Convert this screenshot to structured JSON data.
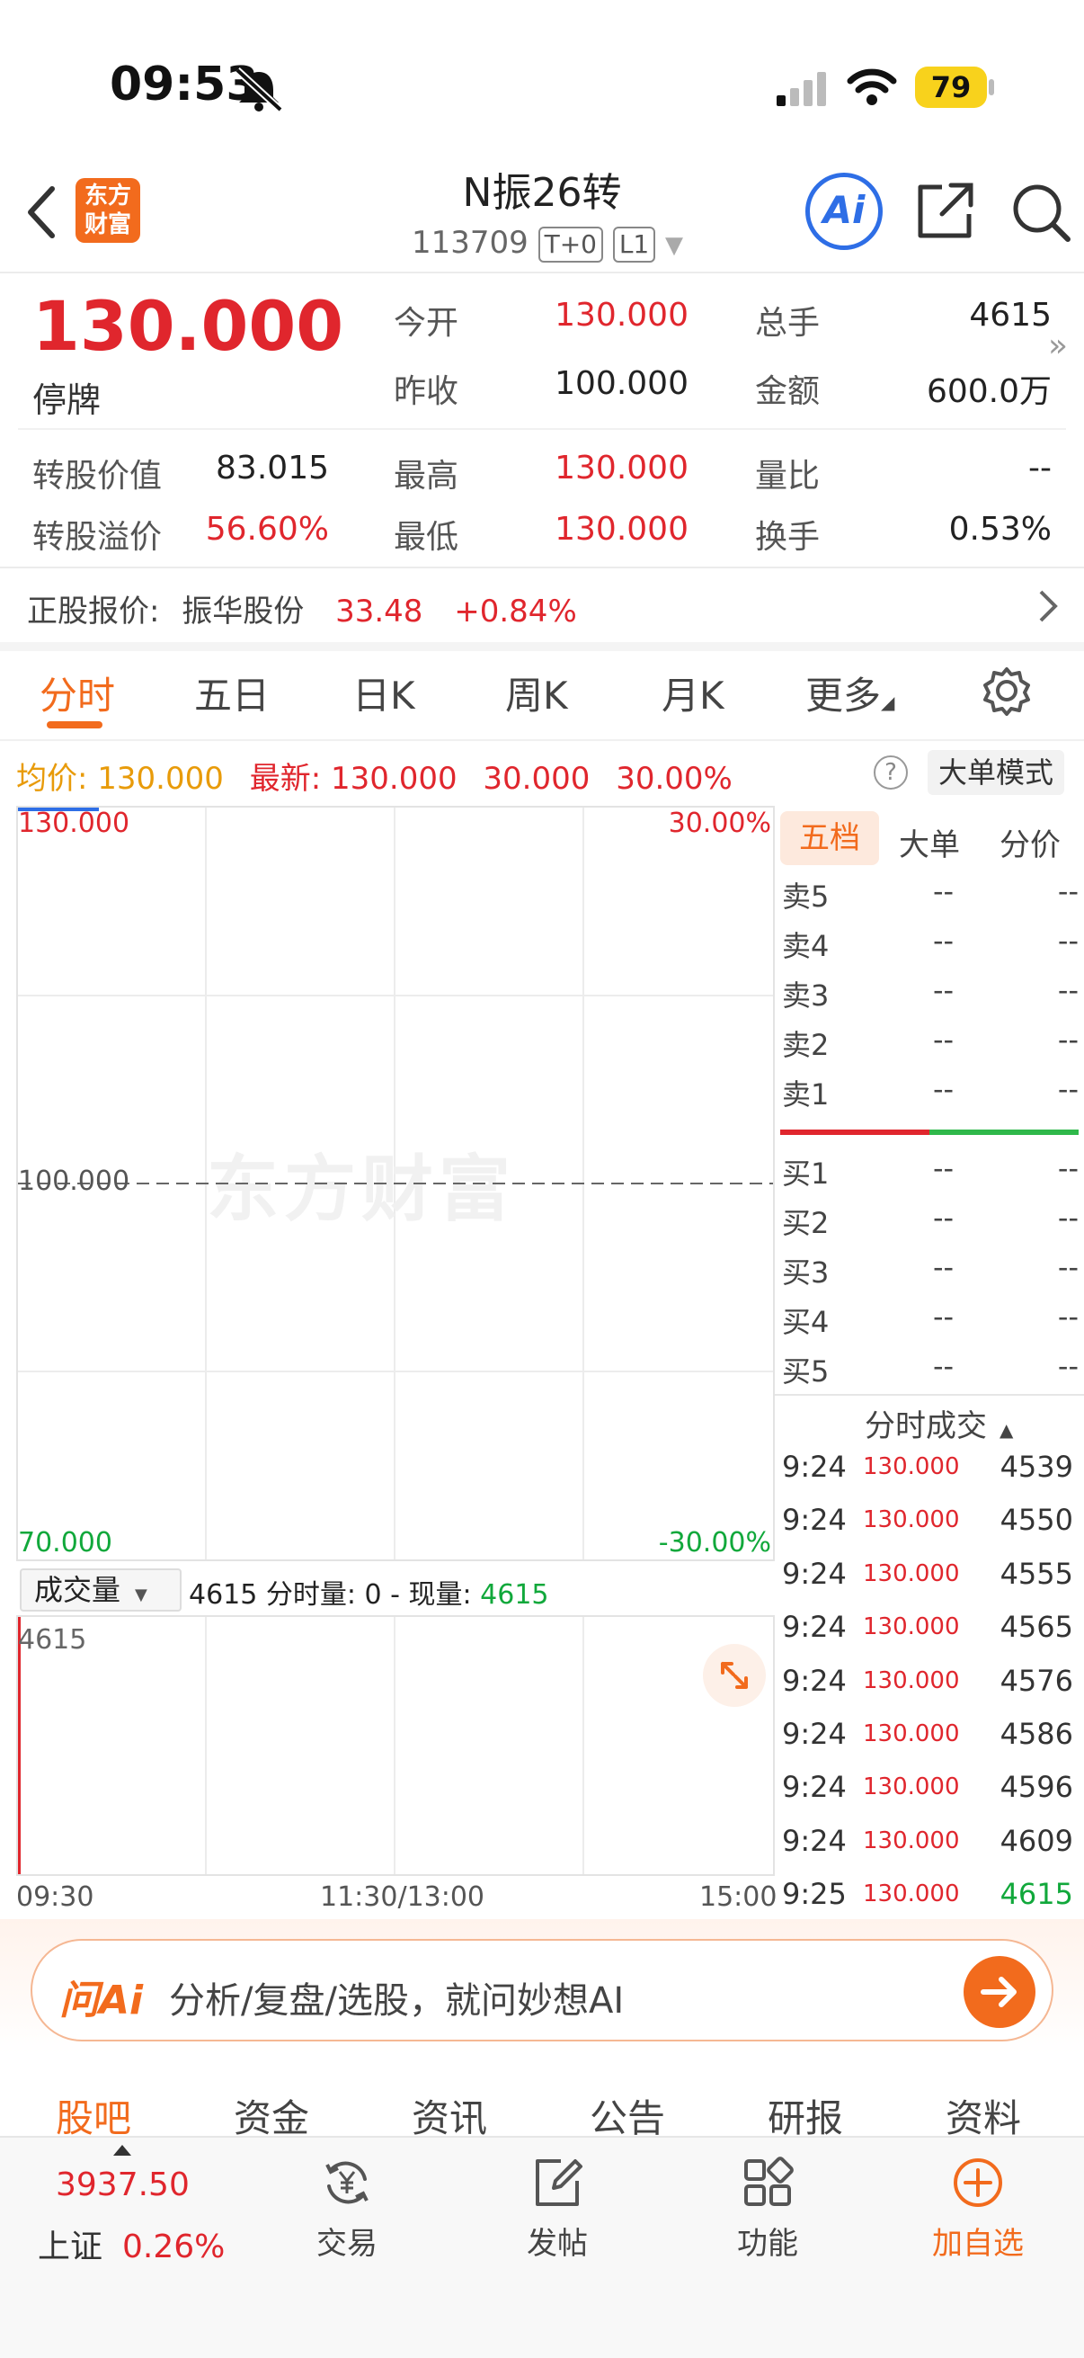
{
  "status_bar": {
    "time": "09:53",
    "battery": "79"
  },
  "header": {
    "title": "N振26转",
    "code": "113709",
    "tag1": "T+0",
    "tag2": "L1",
    "logo_line1": "东方",
    "logo_line2": "财富",
    "ai_label": "Ai"
  },
  "quote": {
    "price": "130.000",
    "state": "停牌",
    "rows": [
      {
        "l1": "今开",
        "v1": "130.000",
        "l2": "总手",
        "v2": "4615"
      },
      {
        "l1": "昨收",
        "v1": "100.000",
        "l2": "金额",
        "v2": "600.0万"
      }
    ],
    "conv_value_label": "转股价值",
    "conv_value": "83.015",
    "conv_premium_label": "转股溢价",
    "conv_premium": "56.60%",
    "high_label": "最高",
    "high": "130.000",
    "low_label": "最低",
    "low": "130.000",
    "vol_ratio_label": "量比",
    "vol_ratio": "--",
    "turnover_label": "换手",
    "turnover": "0.53%"
  },
  "underlying": {
    "label": "正股报价:",
    "name": "振华股份",
    "price": "33.48",
    "change": "+0.84%"
  },
  "tabs": [
    "分时",
    "五日",
    "日K",
    "周K",
    "月K",
    "更多"
  ],
  "chart_info": {
    "avg_label": "均价:",
    "avg": "130.000",
    "latest_label": "最新:",
    "latest": "130.000",
    "chg": "30.000",
    "pct": "30.00%",
    "big_order_mode": "大单模式"
  },
  "chart_data": {
    "type": "line",
    "y_labels": {
      "top": "130.000",
      "mid": "100.000",
      "bottom": "70.000",
      "top_pct": "30.00%",
      "bottom_pct": "-30.00%"
    },
    "x_labels": [
      "09:30",
      "11:30/13:00",
      "15:00"
    ],
    "ylim": [
      70,
      130
    ],
    "prev_close": 100,
    "series": [
      {
        "values": [
          130
        ]
      }
    ],
    "volume_max": "4615",
    "volume": [
      4615
    ]
  },
  "volume_bar": {
    "select": "成交量",
    "text1": "4615 分时量: 0 - 现量:",
    "current": "4615"
  },
  "watermark": "东方财富",
  "orderbook": {
    "tabs": [
      "五档",
      "大单",
      "分价"
    ],
    "sell": [
      {
        "label": "卖5",
        "p": "--",
        "q": "--"
      },
      {
        "label": "卖4",
        "p": "--",
        "q": "--"
      },
      {
        "label": "卖3",
        "p": "--",
        "q": "--"
      },
      {
        "label": "卖2",
        "p": "--",
        "q": "--"
      },
      {
        "label": "卖1",
        "p": "--",
        "q": "--"
      }
    ],
    "buy": [
      {
        "label": "买1",
        "p": "--",
        "q": "--"
      },
      {
        "label": "买2",
        "p": "--",
        "q": "--"
      },
      {
        "label": "买3",
        "p": "--",
        "q": "--"
      },
      {
        "label": "买4",
        "p": "--",
        "q": "--"
      },
      {
        "label": "买5",
        "p": "--",
        "q": "--"
      }
    ]
  },
  "trades": {
    "title": "分时成交",
    "rows": [
      {
        "t": "9:24",
        "p": "130.000",
        "v": "4539"
      },
      {
        "t": "9:24",
        "p": "130.000",
        "v": "4550"
      },
      {
        "t": "9:24",
        "p": "130.000",
        "v": "4555"
      },
      {
        "t": "9:24",
        "p": "130.000",
        "v": "4565"
      },
      {
        "t": "9:24",
        "p": "130.000",
        "v": "4576"
      },
      {
        "t": "9:24",
        "p": "130.000",
        "v": "4586"
      },
      {
        "t": "9:24",
        "p": "130.000",
        "v": "4596"
      },
      {
        "t": "9:24",
        "p": "130.000",
        "v": "4609"
      },
      {
        "t": "9:25",
        "p": "130.000",
        "v": "4615"
      }
    ]
  },
  "ai_bar": {
    "logo": "问Ai",
    "placeholder": "分析/复盘/选股，就问妙想AI"
  },
  "sub_tabs": [
    "股吧",
    "资金",
    "资讯",
    "公告",
    "研报",
    "资料"
  ],
  "bottom_nav": {
    "index_value": "3937.50",
    "index_name": "上证",
    "index_pct": "0.26%",
    "trade": "交易",
    "post": "发帖",
    "func": "功能",
    "add": "加自选"
  }
}
